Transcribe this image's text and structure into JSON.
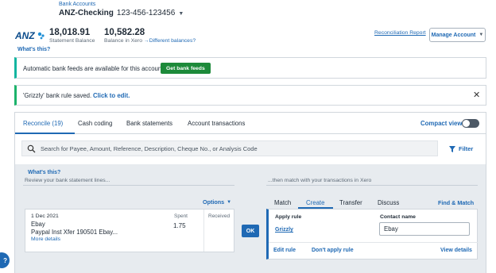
{
  "header": {
    "breadcrumb": "Bank Accounts",
    "account_name": "ANZ-Checking",
    "account_number": "123-456-123456"
  },
  "balances": {
    "statement_amount": "18,018.91",
    "statement_label": "Statement Balance",
    "xero_amount": "10,582.28",
    "xero_label": "Balance in Xero",
    "different_link": "Different balances?",
    "whats_this": "What's this?",
    "reconciliation_report": "Reconciliation Report",
    "manage_account": "Manage Account",
    "logo_text": "ANZ"
  },
  "banners": {
    "bank_feed_text": "Automatic bank feeds are available for this account",
    "get_bank_feeds": "Get bank feeds",
    "rule_text": "'Grizzly' bank rule saved.",
    "click_to_edit": "Click to edit."
  },
  "tabs": {
    "reconcile": "Reconcile (19)",
    "cash_coding": "Cash coding",
    "bank_statements": "Bank statements",
    "account_transactions": "Account transactions",
    "compact_view": "Compact view"
  },
  "search": {
    "placeholder": "Search for Payee, Amount, Reference, Description, Cheque No., or Analysis Code",
    "filter": "Filter"
  },
  "reconcile": {
    "whats_this": "What's this?",
    "review_text": "Review your bank statement lines...",
    "match_text": "...then match with your transactions in Xero",
    "options": "Options",
    "ok": "OK"
  },
  "statement_line": {
    "date": "1 Dec 2021",
    "payee": "Ebay",
    "reference": "Paypal Inst Xfer 190501 Ebay...",
    "more_details": "More details",
    "spent_label": "Spent",
    "spent_value": "1.75",
    "received_label": "Received"
  },
  "match_panel": {
    "tabs": [
      "Match",
      "Create",
      "Transfer",
      "Discuss"
    ],
    "active_tab": "Create",
    "find_match": "Find & Match",
    "apply_rule_label": "Apply rule",
    "rule_name": "Grizzly",
    "contact_label": "Contact name",
    "contact_value": "Ebay",
    "edit_rule": "Edit rule",
    "dont_apply": "Don't apply rule",
    "view_details": "View details"
  },
  "colors": {
    "link": "#1f69b4",
    "success": "#1d8a3a",
    "teal_accent": "#13b5a0",
    "panel_bg": "#e7ebef"
  },
  "help": {
    "label": "Help"
  }
}
